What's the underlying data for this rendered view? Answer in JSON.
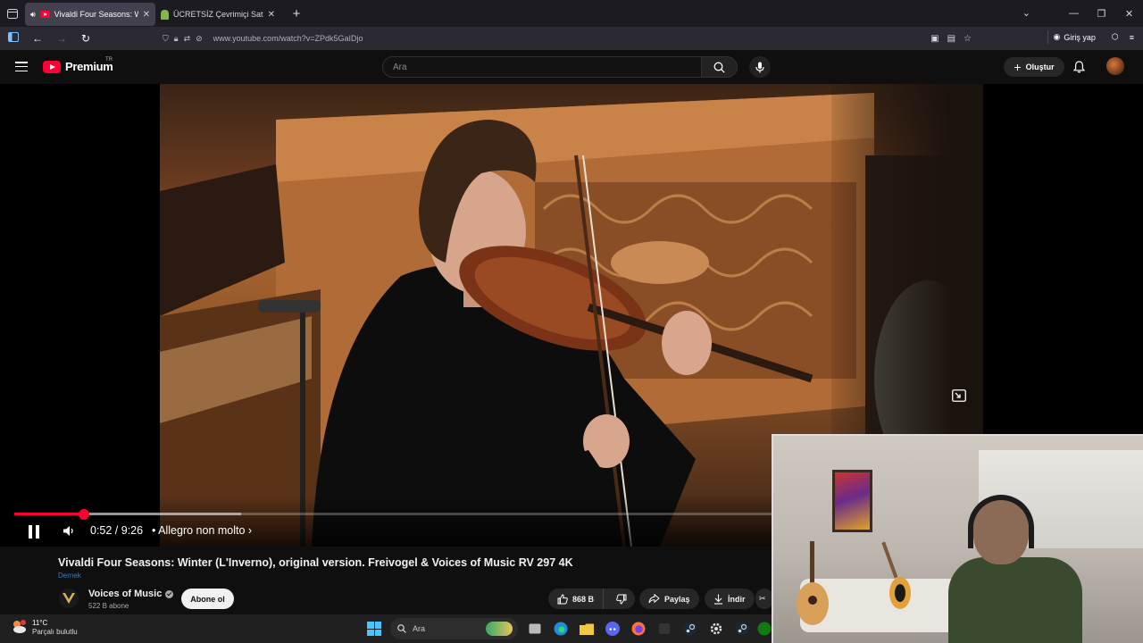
{
  "browser": {
    "tabs": [
      {
        "title": "Vivaldi Four Seasons: Winte",
        "active": true
      },
      {
        "title": "ÜCRETSİZ Çevrimiçi Satranç Oy",
        "active": false
      }
    ],
    "url": "www.youtube.com/watch?v=ZPdk5GaIDjo",
    "signin_label": "Giriş yap"
  },
  "youtube": {
    "logo_text": "Premium",
    "country_code": "TR",
    "search_placeholder": "Ara",
    "create_label": "Oluştur"
  },
  "player": {
    "current_time": "0:52",
    "duration": "9:26",
    "time_display": "0:52 / 9:26",
    "chapter": "• Allegro non molto ›",
    "played_fraction": 0.092,
    "buffered_fraction": 0.3
  },
  "video": {
    "title": "Vivaldi Four Seasons: Winter (L'Inverno), original version. Freivogel & Voices of Music RV 297 4K",
    "badge": "Dernek",
    "channel_name": "Voices of Music",
    "subscribers": "522 B abone",
    "subscribe_label": "Abone ol",
    "likes": "868 B",
    "share_label": "Paylaş",
    "download_label": "İndir"
  },
  "taskbar": {
    "temperature": "11°C",
    "weather": "Parçalı bulutlu",
    "search_label": "Ara"
  },
  "colors": {
    "brand_red": "#ff0033",
    "background": "#0f0f0f",
    "browser_chrome": "#2b2a33"
  }
}
